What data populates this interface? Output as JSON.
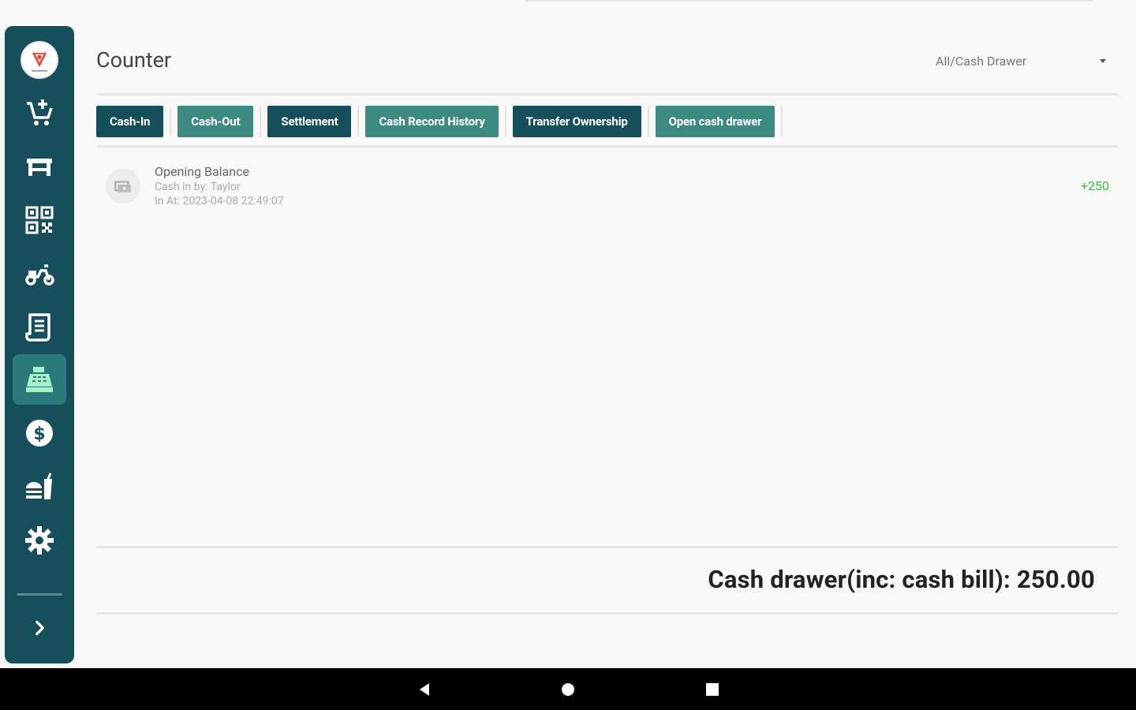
{
  "header": {
    "title": "Counter",
    "drawer_select": "All/Cash Drawer"
  },
  "toolbar": [
    {
      "label": "Cash-In",
      "style": "dark"
    },
    {
      "label": "Cash-Out",
      "style": "teal"
    },
    {
      "label": "Settlement",
      "style": "dark"
    },
    {
      "label": "Cash Record History",
      "style": "teal"
    },
    {
      "label": "Transfer Ownership",
      "style": "dark"
    },
    {
      "label": "Open cash drawer",
      "style": "teal"
    }
  ],
  "records": [
    {
      "title": "Opening Balance",
      "by": "Cash in by: Taylor",
      "at": "In At: 2023-04-08 22:49:07",
      "amount": "+250"
    }
  ],
  "summary": {
    "text": "Cash drawer(inc: cash bill): 250.00"
  },
  "sidebar": {
    "items": [
      {
        "name": "cart-add-icon"
      },
      {
        "name": "table-icon"
      },
      {
        "name": "qr-code-icon"
      },
      {
        "name": "scooter-icon"
      },
      {
        "name": "receipt-icon"
      },
      {
        "name": "cash-register-icon",
        "active": true
      },
      {
        "name": "dollar-icon"
      },
      {
        "name": "food-icon"
      },
      {
        "name": "gear-icon"
      }
    ]
  },
  "colors": {
    "sidebar": "#174e5c",
    "active": "#2a7a7a",
    "active_icon": "#a8f0c8",
    "button_dark": "#174e5c",
    "button_teal": "#3d8a82",
    "amount_positive": "#4caf50"
  }
}
